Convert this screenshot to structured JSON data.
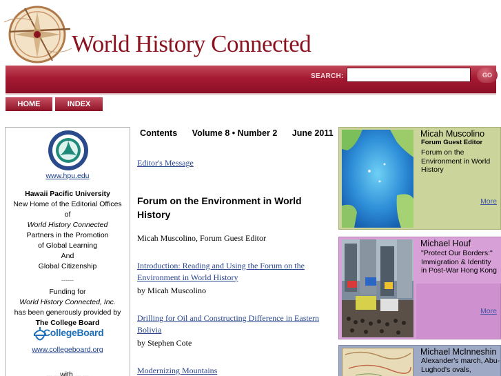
{
  "header": {
    "site_title": "World History Connected"
  },
  "search": {
    "label": "SEARCH:",
    "value": "",
    "placeholder": "",
    "go_label": "GO"
  },
  "nav": {
    "home": "HOME",
    "index": "INDEX"
  },
  "left_sidebar": {
    "hpu_url": "www.hpu.edu",
    "hpu_name": "Hawaii Pacific University",
    "lines": [
      "New Home of the Editorial Offices",
      "of"
    ],
    "whc_italic": "World History Connected",
    "partner_lines": [
      "Partners in the Promotion",
      "of Global Learning",
      "And",
      "Global Citizenship"
    ],
    "divider": "------",
    "funding_for": "Funding for",
    "funding_org_italic": "World History Connected, Inc.",
    "funding_provided": "has been generously provided by",
    "sponsor": "The College Board",
    "cb_logo_text": "CollegeBoard",
    "cb_url": "www.collegeboard.org",
    "trailing": "... ...with ... ..."
  },
  "contents": {
    "label": "Contents",
    "volume": "Volume 8 • Number 2",
    "date": "June 2011"
  },
  "articles": {
    "editors_message": "Editor's Message",
    "forum_heading": "Forum on the Environment in World History",
    "forum_editor": "Micah Muscolino, Forum Guest Editor",
    "a1_title": "Introduction: Reading and Using the Forum on the Environment in World History",
    "a1_author": "by Micah Muscolino",
    "a2_title": "Drilling for Oil and Constructing Difference in Eastern Bolivia",
    "a2_author": "by Stephen Cote",
    "a3_title": "Modernizing Mountains"
  },
  "cards": [
    {
      "name": "Micah Muscolino",
      "role": "Forum Guest Editor",
      "desc": "Forum on the Environment in World History",
      "more": "More",
      "bg": "#cbd49a"
    },
    {
      "name": "Michael Houf",
      "desc": "\"Protect Our Borders:\" Immigration & Identity in Post-War Hong Kong",
      "more": "More",
      "bg": "#d7a0d7"
    },
    {
      "name": "Michael McInneshin",
      "desc": "Alexander's march, Abu-Lughod's ovals,",
      "bg": "#9ea9c6"
    }
  ],
  "colors": {
    "brand": "#8b1320",
    "link": "#27448c"
  }
}
